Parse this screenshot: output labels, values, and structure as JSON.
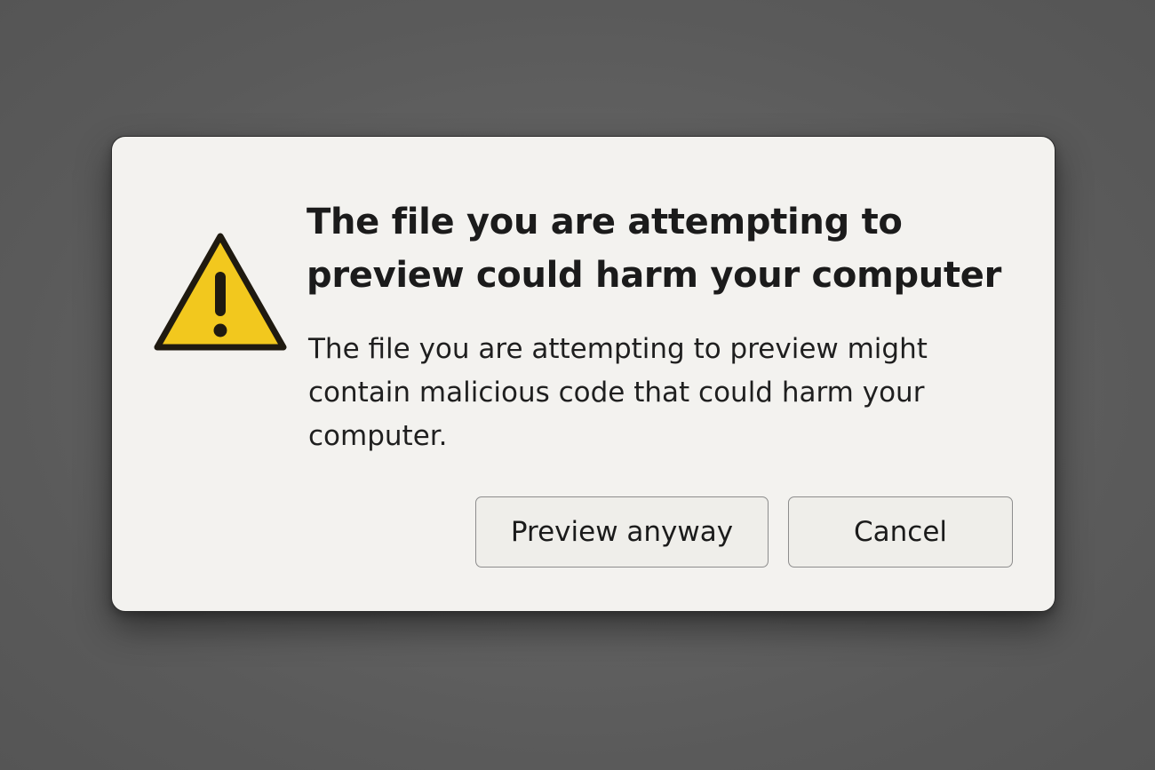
{
  "dialog": {
    "title": "The file you are attempting to preview could harm your computer",
    "message": "The file you are attempting to preview might contain malicious code that could harm your computer.",
    "icon": "warning-triangle-icon",
    "icon_color": "#F2C81E",
    "buttons": {
      "preview_label": "Preview anyway",
      "cancel_label": "Cancel"
    }
  }
}
